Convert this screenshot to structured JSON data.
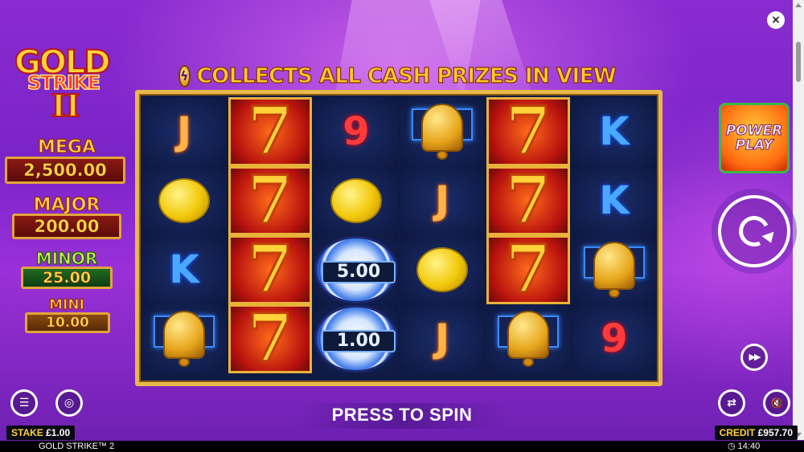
{
  "window": {
    "close_glyph": "×"
  },
  "logo": {
    "line1": "GOLD",
    "line2": "STRIKE",
    "line3": "II"
  },
  "jackpots": [
    {
      "name": "MEGA",
      "value": "2,500.00"
    },
    {
      "name": "MAJOR",
      "value": "200.00"
    },
    {
      "name": "MINOR",
      "value": "25.00"
    },
    {
      "name": "MINI",
      "value": "10.00"
    }
  ],
  "banner": {
    "text": "COLLECTS ALL CASH PRIZES IN VIEW",
    "icon": "lightning-coin-icon"
  },
  "reels": {
    "columns": 6,
    "rows": 4,
    "grid": [
      [
        "J",
        "7",
        "9",
        "BELL",
        "7",
        "K"
      ],
      [
        "LEMON",
        "7",
        "LEMON",
        "J",
        "7",
        "K"
      ],
      [
        "K",
        "7",
        "CHIP",
        "LEMON",
        "7",
        "BELL"
      ],
      [
        "BELL",
        "7",
        "CHIP",
        "J",
        "BELL",
        "9"
      ]
    ],
    "chips": [
      "5.00",
      "1.00"
    ]
  },
  "controls": {
    "power_play_line1": "POWER",
    "power_play_line2": "PLAY",
    "spin_icon": "spin-arrow-icon",
    "autoplay_glyph": "▶▶",
    "menu_glyph": "☰",
    "coins_glyph": "◎",
    "swap_glyph": "⇄",
    "sound_glyph": "🔇"
  },
  "press_to_spin": "PRESS TO SPIN",
  "stake": {
    "label": "STAKE",
    "value": "£1.00"
  },
  "credit": {
    "label": "CREDIT",
    "value": "£957.70"
  },
  "footer": {
    "game_title": "GOLD STRIKE™ 2",
    "time": "14:40"
  },
  "colors": {
    "accent_gold": "#ffd23a",
    "background_purple": "#8a2bd0",
    "reel_frame": "#e8b84a"
  }
}
